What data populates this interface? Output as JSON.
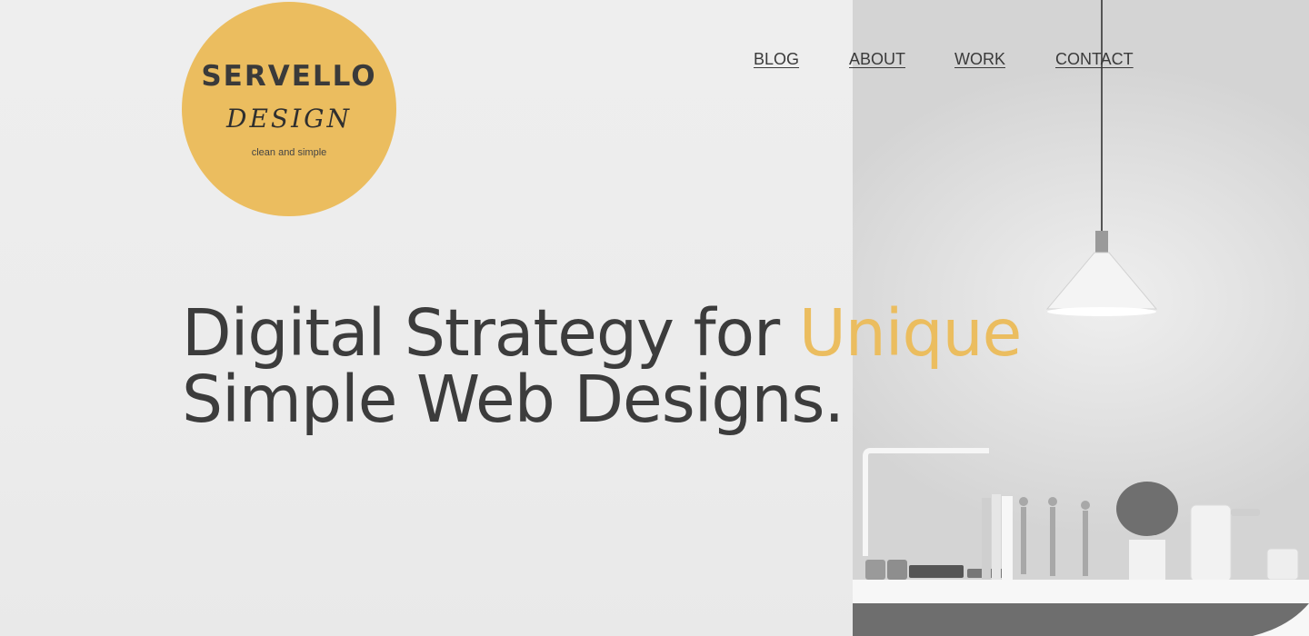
{
  "logo": {
    "title": "SERVELLO",
    "subtitle": "DESIGN",
    "tagline": "clean and simple"
  },
  "nav": {
    "items": [
      "BLOG",
      "ABOUT",
      "WORK",
      "CONTACT"
    ]
  },
  "hero": {
    "line1_prefix": "Digital Strategy for ",
    "line1_accent": "Unique",
    "line2": "Simple Web Designs."
  },
  "colors": {
    "accent": "#ebbd5f",
    "text": "#3c3c3c",
    "background": "#ededed"
  },
  "background_image": "interior-desk-shelf-with-pendant-lamp"
}
